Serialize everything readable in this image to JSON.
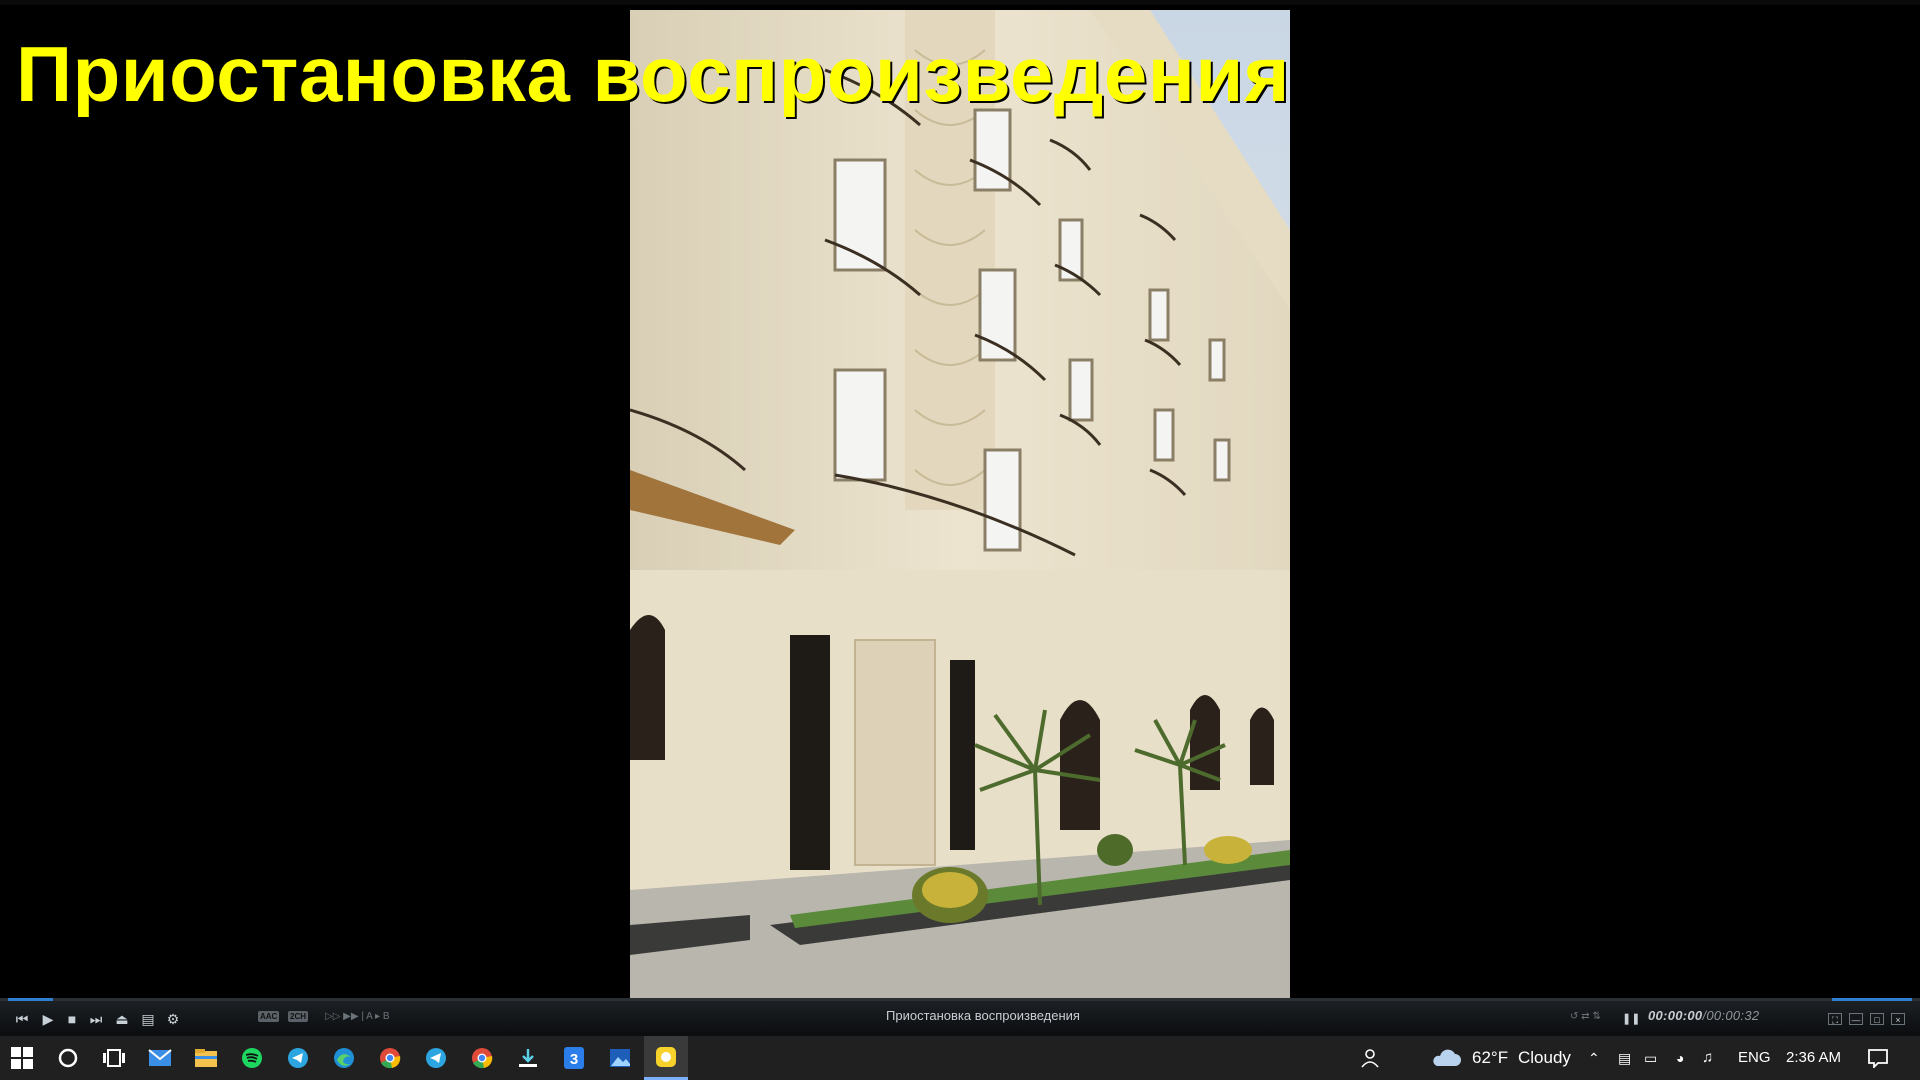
{
  "player": {
    "osd_message": "Приостановка воспроизведения",
    "status_text": "Приостановка воспроизведения",
    "time_current": "00:00:00",
    "time_separator": "/",
    "time_duration": "00:00:32",
    "badges": [
      "AAC",
      "2CH"
    ],
    "accent_color": "#2f7fd0",
    "osd_color": "#ffff00"
  },
  "taskbar": {
    "apps": [
      "start-icon",
      "search-icon",
      "task-view-icon",
      "mail-icon",
      "file-explorer-icon",
      "spotify-icon",
      "telegram-icon",
      "edge-icon",
      "chrome-icon",
      "telegram-icon",
      "chrome-icon",
      "download-icon",
      "app-3-icon",
      "photos-icon",
      "potplayer-icon"
    ],
    "weather_temp": "62°F",
    "weather_desc": "Cloudy",
    "language": "ENG",
    "clock": "2:36 AM"
  }
}
